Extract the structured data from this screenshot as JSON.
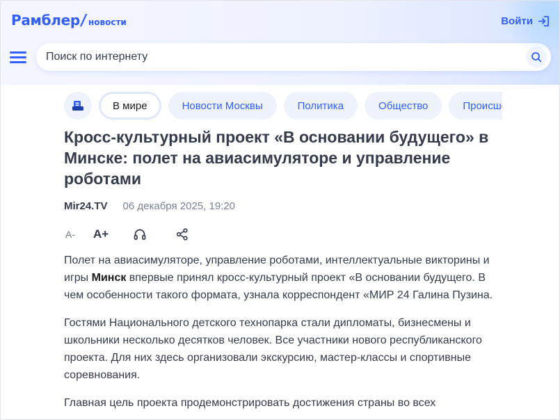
{
  "header": {
    "logo_main": "Рамблер",
    "logo_slash": "/",
    "logo_sub": "новости",
    "login_label": "Войти",
    "login_icon": "login-arrow-icon",
    "menu_icon": "hamburger-menu-icon",
    "search_placeholder": "Поиск по интернету",
    "search_value": "",
    "search_icon": "search-icon"
  },
  "tabs": {
    "home_icon": "rambler-news-icon",
    "items": [
      {
        "label": "В мире",
        "active": true
      },
      {
        "label": "Новости Москвы",
        "active": false
      },
      {
        "label": "Политика",
        "active": false
      },
      {
        "label": "Общество",
        "active": false
      },
      {
        "label": "Происшествия",
        "active": false
      }
    ]
  },
  "article": {
    "title": "Кросс-культурный проект «В основании будущего» в Минске: полет на авиасимуляторе и управление роботами",
    "source": "Mir24.TV",
    "date": "06 декабря 2025, 19:20",
    "tools": {
      "font_small": "A-",
      "font_large": "A+",
      "listen_icon": "headphones-icon",
      "share_icon": "share-icon"
    },
    "paragraphs": [
      {
        "before": "Полет на авиасимуляторе, управление роботами, интеллектуальные викторины и игры ",
        "bold": "Минск",
        "after": " впервые принял кросс-культурный проект «В основании будущего. В чем особенности такого формата, узнала корреспондент «МИР 24 Галина Пузина."
      },
      {
        "before": "Гостями Национального детского технопарка стали дипломаты, бизнесмены и школьники несколько десятков человек. Все участники нового республиканского проекта. Для них здесь организовали экскурсию, мастер-классы и спортивные соревнования.",
        "bold": "",
        "after": ""
      },
      {
        "before": "Главная цель проекта продемонстрировать достижения страны во всех",
        "bold": "",
        "after": ""
      }
    ]
  },
  "colors": {
    "brand": "#315efb",
    "text": "#343b4c",
    "muted": "#7a8195",
    "tab_bg": "#eef2fc"
  }
}
